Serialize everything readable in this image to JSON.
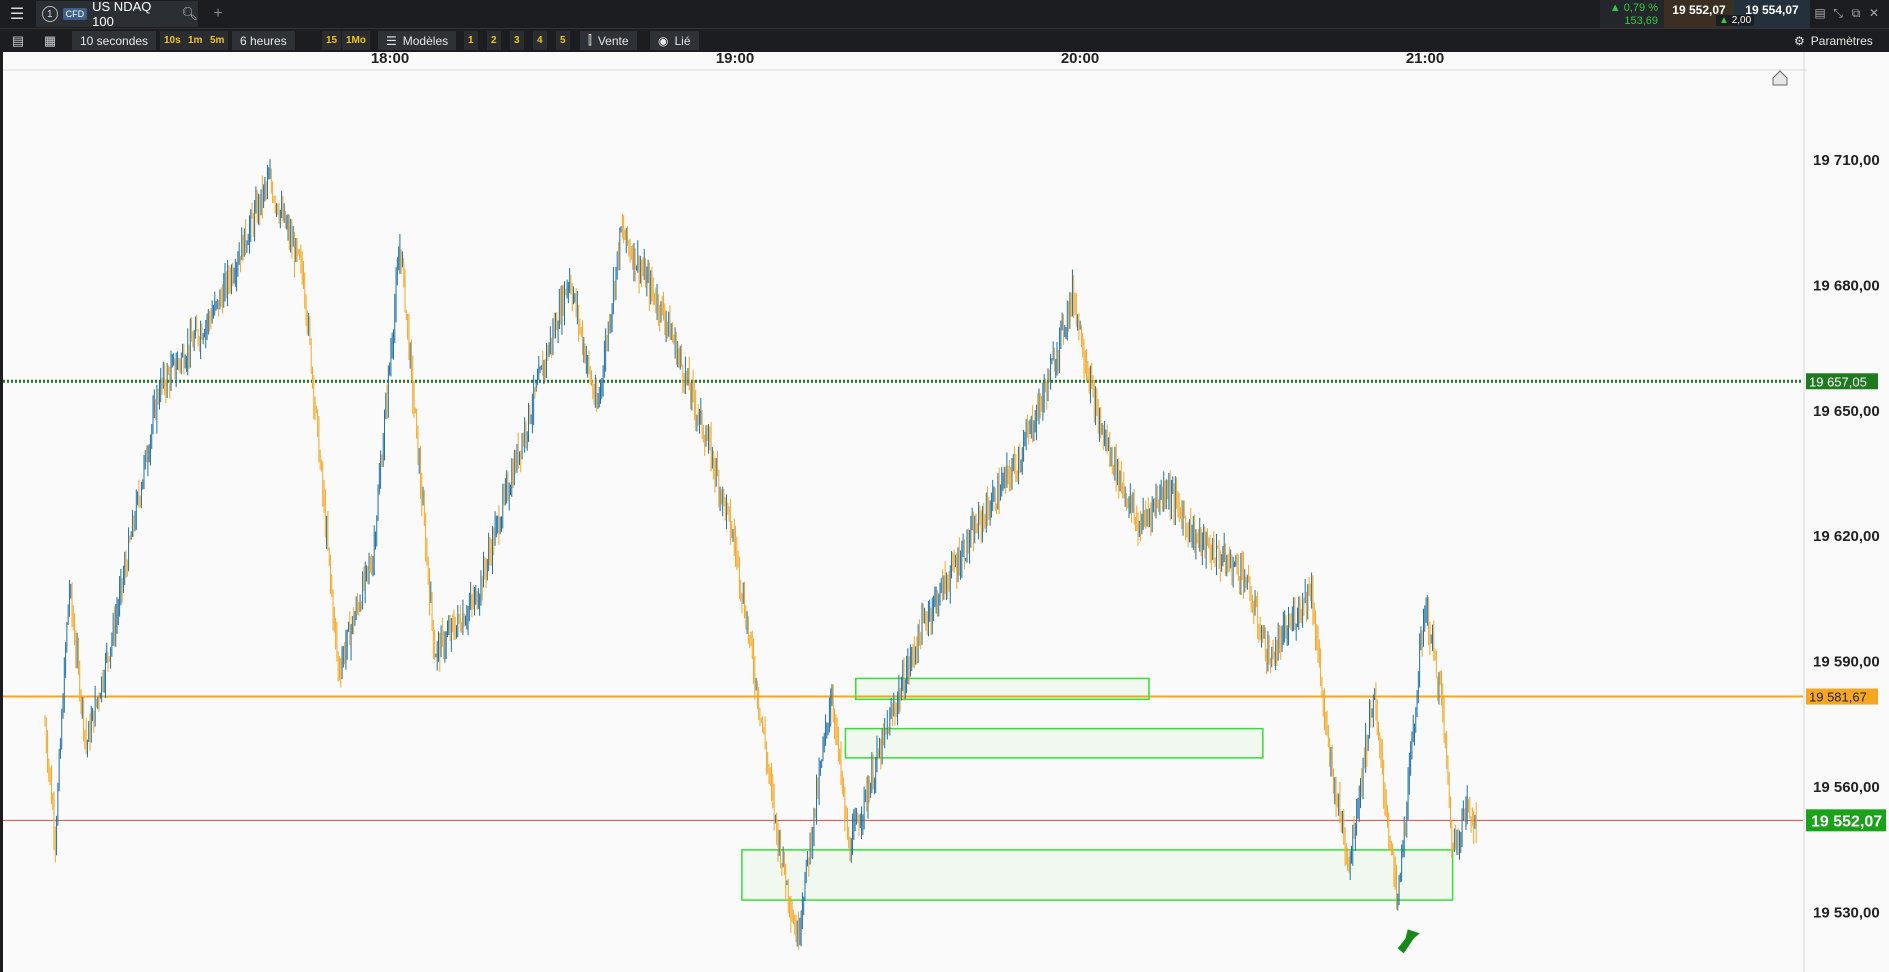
{
  "window": {
    "menu_icon": "hamburger-icon",
    "tab": {
      "index": "1",
      "type": "CFD",
      "symbol": "US NDAQ 100",
      "search_icon": "search-icon"
    },
    "add_tab": "+"
  },
  "quote": {
    "change_pct": "▲ 0,79 %",
    "change_abs": "153,69",
    "sell_price": "19 552,07",
    "buy_price": "19 554,07",
    "spread": "2,00",
    "spread_arrow": "▲"
  },
  "toolbar": {
    "interval": "10 secondes",
    "quick_intervals": [
      "10s",
      "1m",
      "5m"
    ],
    "range": "6 heures",
    "range_quick": [
      "15",
      "1Mo"
    ],
    "templates": "Modèles",
    "layouts": [
      "1",
      "2",
      "3",
      "4",
      "5"
    ],
    "sell": "Vente",
    "linked": "Lié",
    "settings": "Paramètres"
  },
  "chart_data": {
    "type": "candlestick",
    "x_ticks": [
      "18:00",
      "19:00",
      "20:00",
      "21:00"
    ],
    "y_ticks": [
      "19 710,00",
      "19 680,00",
      "19 650,00",
      "19 620,00",
      "19 590,00",
      "19 560,00",
      "19 530,00"
    ],
    "y_tick_values": [
      19710,
      19680,
      19650,
      19620,
      19590,
      19560,
      19530
    ],
    "ylim": [
      19517,
      19731
    ],
    "x_range_minutes": [
      17.0,
      21.1
    ],
    "price_path": [
      [
        17.0,
        19575
      ],
      [
        17.03,
        19548
      ],
      [
        17.07,
        19608
      ],
      [
        17.12,
        19570
      ],
      [
        17.2,
        19598
      ],
      [
        17.33,
        19655
      ],
      [
        17.5,
        19675
      ],
      [
        17.65,
        19705
      ],
      [
        17.75,
        19682
      ],
      [
        17.85,
        19588
      ],
      [
        17.95,
        19615
      ],
      [
        18.03,
        19690
      ],
      [
        18.13,
        19592
      ],
      [
        18.25,
        19605
      ],
      [
        18.4,
        19648
      ],
      [
        18.52,
        19682
      ],
      [
        18.6,
        19650
      ],
      [
        18.67,
        19693
      ],
      [
        18.8,
        19672
      ],
      [
        18.93,
        19640
      ],
      [
        19.0,
        19618
      ],
      [
        19.07,
        19580
      ],
      [
        19.12,
        19550
      ],
      [
        19.18,
        19524
      ],
      [
        19.28,
        19583
      ],
      [
        19.33,
        19545
      ],
      [
        19.45,
        19576
      ],
      [
        19.55,
        19600
      ],
      [
        19.7,
        19622
      ],
      [
        19.82,
        19638
      ],
      [
        19.9,
        19655
      ],
      [
        19.98,
        19678
      ],
      [
        20.05,
        19648
      ],
      [
        20.17,
        19622
      ],
      [
        20.25,
        19632
      ],
      [
        20.33,
        19620
      ],
      [
        20.42,
        19614
      ],
      [
        20.47,
        19612
      ],
      [
        20.55,
        19590
      ],
      [
        20.67,
        19608
      ],
      [
        20.72,
        19568
      ],
      [
        20.78,
        19542
      ],
      [
        20.85,
        19582
      ],
      [
        20.92,
        19532
      ],
      [
        21.0,
        19604
      ],
      [
        21.05,
        19580
      ],
      [
        21.08,
        19545
      ],
      [
        21.12,
        19555
      ],
      [
        21.15,
        19552
      ]
    ],
    "levels": [
      {
        "value": 19657.05,
        "label": "19 657,05",
        "style": "dotted",
        "color": "#1a7a1a"
      },
      {
        "value": 19581.67,
        "label": "19 581,67",
        "style": "solid",
        "color": "#f5a623"
      },
      {
        "value": 19552.07,
        "label": "19 552,07",
        "style": "current",
        "color": "#e04848"
      }
    ],
    "zones": [
      {
        "x1": 19.35,
        "x2": 20.2,
        "y1": 19586,
        "y2": 19581
      },
      {
        "x1": 19.32,
        "x2": 20.53,
        "y1": 19574,
        "y2": 19567
      },
      {
        "x1": 19.02,
        "x2": 21.08,
        "y1": 19545,
        "y2": 19533
      }
    ],
    "colors": {
      "up": "#1f6fa8",
      "down": "#f5a623",
      "zone": "#35e035",
      "current_label": "#1aa31a"
    },
    "arrow": {
      "x": 20.95,
      "y": 19526,
      "color": "#168a16"
    }
  }
}
